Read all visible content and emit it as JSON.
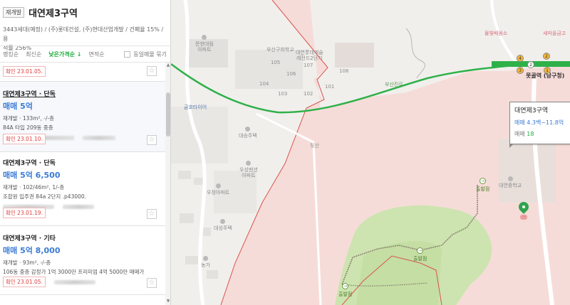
{
  "panel": {
    "type_badge": "재개발",
    "title": "대연제3구역",
    "info_line1": "3443세대(예정) / (주)롯데건설, (주)현대산업개발 / 건폐율 15% / 용",
    "info_line2": "적률 256%",
    "sort": {
      "items": [
        "랭킹순",
        "최신순",
        "낮은가격순 ↓",
        "면적순"
      ],
      "active_index": 2,
      "same_listing_label": "동일매물 묶기"
    },
    "listings": [
      {
        "date": "확인 23.01.05."
      },
      {
        "name": "대연제3구역 · 단독",
        "price": "매매 5억",
        "spec": "재개발 · 133m², -/-층",
        "desc": "84A 타입 209동 중층",
        "date": "확인 23.01.10."
      },
      {
        "name": "대연제3구역 · 단독",
        "price": "매매 5억 6,500",
        "spec": "재개발 · 102/46m², 1/-층",
        "desc": "조합원 입주권 84a 2단지 .p43000.",
        "date": "확인 23.01.19."
      },
      {
        "name": "대연제3구역 · 기타",
        "price": "매매 5억 8,000",
        "spec": "재개발 · 93m², -/-층",
        "desc": "106동 중층 감정가 1억 3000만 프리미엄 4억 5000만 매매가",
        "date": "확인 23.01.05."
      }
    ],
    "star_icon": "☆"
  },
  "map": {
    "tooltip": {
      "title": "대연제3구역",
      "price": "매매 4.3백~11.8억",
      "count_label": "매매",
      "count": "18"
    },
    "labels": {
      "munhyeon_apt": "문현대림\n아파트",
      "busan_girls_school": "부산구화학교",
      "lotte_castle": "대연롯데캐슬\n레전드2단지",
      "geumho_tire": "금호타이어",
      "daeseung_house": "대승주택",
      "woosung_mansion": "우성맨션\n아파트",
      "woojeong_apt": "우정아파트",
      "daeseong_house": "대성주택",
      "nongga": "농가",
      "chulbal1": "출발점",
      "chulbal2": "출발점",
      "chulbal3": "출발점",
      "daeyeon_middle": "대연중학교",
      "mulbit_school": "물빛배움소",
      "saemaeul": "새마을금고",
      "namgu_office": "남구청",
      "station": "못골역\n(남구청)",
      "road_busan": "부산진로",
      "mountain": "뒷산",
      "buildings": [
        "105",
        "106",
        "107",
        "104",
        "103",
        "102",
        "101",
        "108"
      ]
    },
    "colors": {
      "accent_green": "#1cae3c",
      "price_blue": "#3a7bd5",
      "date_red": "#e03b3b",
      "subway_green": "#2fb14a"
    }
  }
}
